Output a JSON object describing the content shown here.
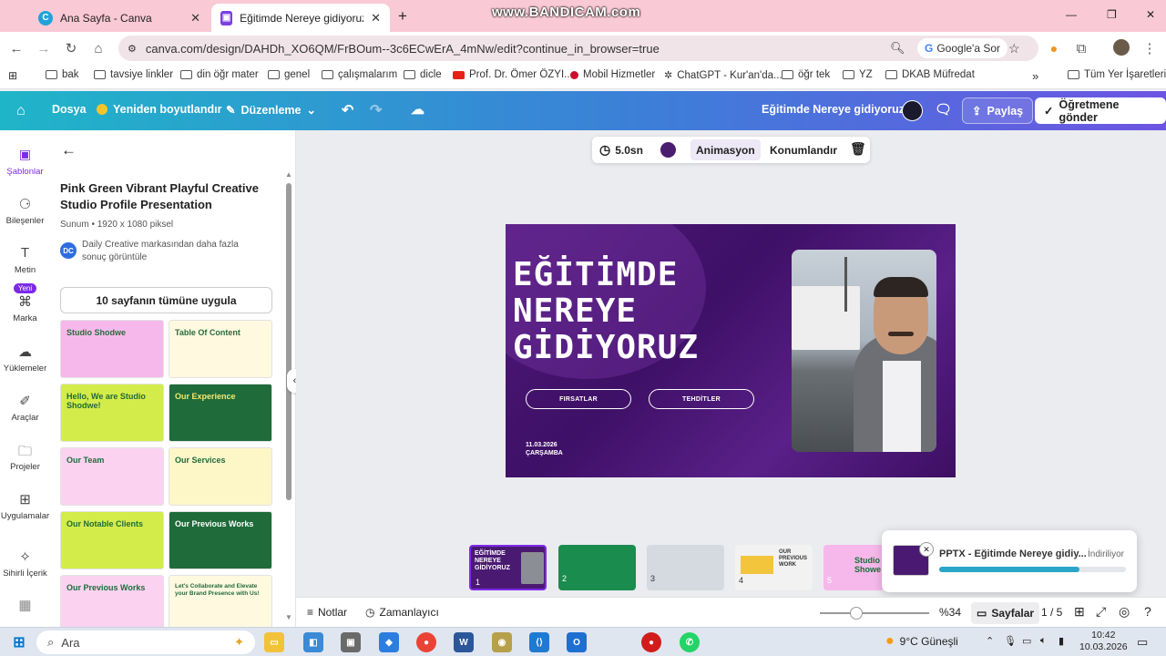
{
  "watermark": "www.BANDICAM.com",
  "tabs": [
    {
      "title": "Ana Sayfa - Canva",
      "close": "✕"
    },
    {
      "title": "Eğitimde Nereye gidiyoruz - Su",
      "close": "✕"
    }
  ],
  "new_tab": "+",
  "window": {
    "min": "—",
    "max": "❐",
    "close": "✕"
  },
  "address": {
    "url": "canva.com/design/DAHDh_XO6QM/FrBOum--3c6ECwErA_4mNw/edit?continue_in_browser=true",
    "google_ask": "Google'a Sor"
  },
  "bookmarks": [
    "bak",
    "tavsiye linkler",
    "din öğr mater",
    "genel",
    "çalışmalarım",
    "dicle",
    "Prof. Dr. Ömer ÖZYI...",
    "Mobil Hizmetler",
    "ChatGPT - Kur'an'da...",
    "öğr tek",
    "YZ",
    "DKAB Müfredat"
  ],
  "bookmarks_more": "»",
  "all_bookmarks": "Tüm Yer İşaretleri",
  "canva_bar": {
    "file": "Dosya",
    "resize": "Yeniden boyutlandır",
    "edit": "Düzenleme",
    "doc_title": "Eğitimde Nereye gidiyoruz",
    "share": "Paylaş",
    "send_teacher": "Öğretmene gönder"
  },
  "rail": [
    {
      "label": "Şablonlar",
      "icon": "template-icon"
    },
    {
      "label": "Bileşenler",
      "icon": "elements-icon"
    },
    {
      "label": "Metin",
      "icon": "text-icon"
    },
    {
      "label": "Marka",
      "icon": "brand-icon",
      "badge": "Yeni"
    },
    {
      "label": "Yüklemeler",
      "icon": "upload-icon"
    },
    {
      "label": "Araçlar",
      "icon": "tools-icon"
    },
    {
      "label": "Projeler",
      "icon": "folder-icon"
    },
    {
      "label": "Uygulamalar",
      "icon": "apps-icon"
    },
    {
      "label": "Sihirli İçerik",
      "icon": "magic-icon"
    }
  ],
  "panel": {
    "title": "Pink Green Vibrant Playful Creative Studio Profile Presentation",
    "meta": "Sunum • 1920 x 1080 piksel",
    "creator_initials": "DC",
    "creator_text": "Daily Creative markasından daha fazla sonuç görüntüle",
    "apply_all": "10 sayfanın tümüne uygula",
    "thumbs": [
      {
        "text": "Studio Shodwe",
        "bg": "#f6b8ea",
        "fg": "#2a6b3c"
      },
      {
        "text": "Table Of Content",
        "bg": "#fff9e0",
        "fg": "#2a6b3c"
      },
      {
        "text": "Hello, We are Studio Shodwe!",
        "bg": "#d4ec4a",
        "fg": "#1f6b3a"
      },
      {
        "text": "Our Experience",
        "bg": "#1f6b3a",
        "fg": "#f5e96a"
      },
      {
        "text": "Our Team",
        "bg": "#fbd3f1",
        "fg": "#1f6b3a"
      },
      {
        "text": "Our Services",
        "bg": "#fdf7c8",
        "fg": "#1f6b3a"
      },
      {
        "text": "Our Notable Clients",
        "bg": "#d4ec4a",
        "fg": "#1f6b3a"
      },
      {
        "text": "Our Previous Works",
        "bg": "#1f6b3a",
        "fg": "#ffffff"
      },
      {
        "text": "Our Previous Works",
        "bg": "#fbd3f1",
        "fg": "#1f6b3a"
      },
      {
        "text": "Let's Collaborate and Elevate your Brand Presence with Us!",
        "bg": "#fff9e0",
        "fg": "#1f6b3a"
      }
    ]
  },
  "context_bar": {
    "duration": "5.0sn",
    "color": "#4b1d6e",
    "animation": "Animasyon",
    "position": "Konumlandır"
  },
  "slide": {
    "title_lines": [
      "EĞİTİMDE",
      "NEREYE",
      "GİDİYORUZ"
    ],
    "btn1": "FIRSATLAR",
    "btn2": "TEHDİTLER",
    "date": "11.03.2026",
    "day": "ÇARŞAMBA"
  },
  "pages": [
    {
      "num": "1",
      "label": "EĞİTİMDE NEREYE GİDİYORUZ"
    },
    {
      "num": "2",
      "label": ""
    },
    {
      "num": "3",
      "label": ""
    },
    {
      "num": "4",
      "label": "OUR PREVIOUS WORK"
    },
    {
      "num": "5",
      "label": "Studio Showe"
    }
  ],
  "footer": {
    "notes": "Notlar",
    "timer": "Zamanlayıcı",
    "zoom": "%34",
    "pages_label": "Sayfalar",
    "page_count": "1 / 5"
  },
  "toast": {
    "title": "PPTX - Eğitimde Nereye gidiy...",
    "status": "İndiriliyor",
    "progress": 0.75
  },
  "taskbar": {
    "search": "Ara",
    "weather": "9°C  Güneşli",
    "time": "10:42",
    "date": "10.03.2026"
  }
}
